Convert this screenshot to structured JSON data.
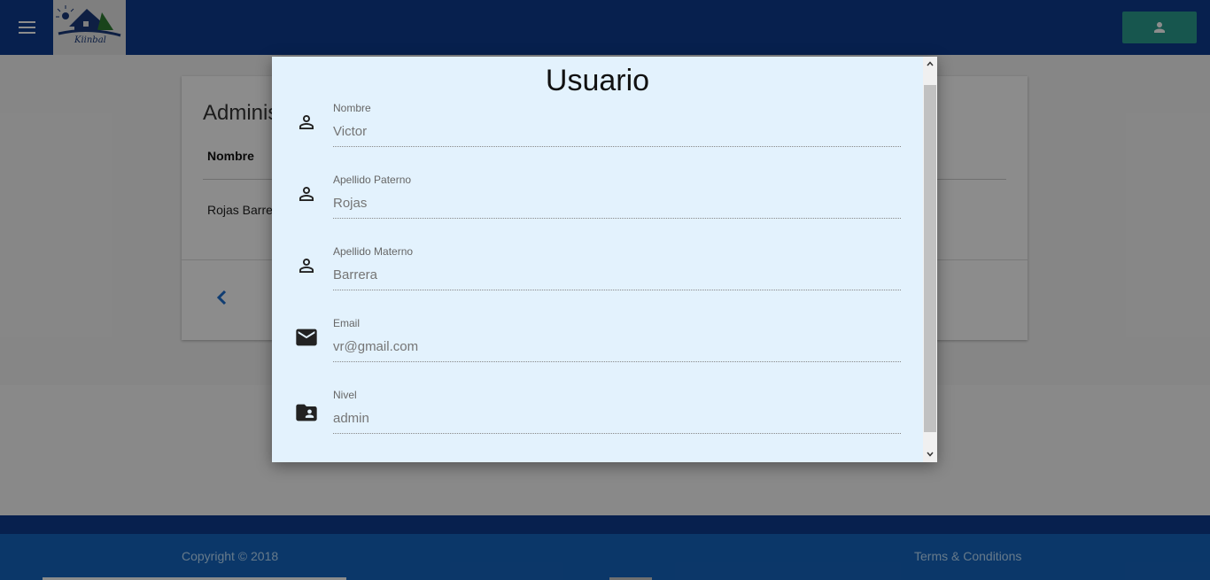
{
  "header": {
    "logo_text": "Kiinbal",
    "colors": {
      "bar": "#0d3b8e",
      "user_button": "#2a9d8f"
    }
  },
  "page": {
    "card_title": "Administ",
    "column_header": "Nombre",
    "row_value": "Rojas Barre",
    "prev_icon": "‹"
  },
  "footer": {
    "copyright": "Copyright © 2018",
    "terms": "Terms & Conditions"
  },
  "modal": {
    "title": "Usuario",
    "fields": [
      {
        "label": "Nombre",
        "value": "Victor",
        "icon": "person-outline-icon"
      },
      {
        "label": "Apellido Paterno",
        "value": "Rojas",
        "icon": "person-outline-icon"
      },
      {
        "label": "Apellido Materno",
        "value": "Barrera",
        "icon": "person-outline-icon"
      },
      {
        "label": "Email",
        "value": "vr@gmail.com",
        "icon": "email-icon"
      },
      {
        "label": "Nivel",
        "value": "admin",
        "icon": "folder-shared-icon"
      }
    ]
  }
}
